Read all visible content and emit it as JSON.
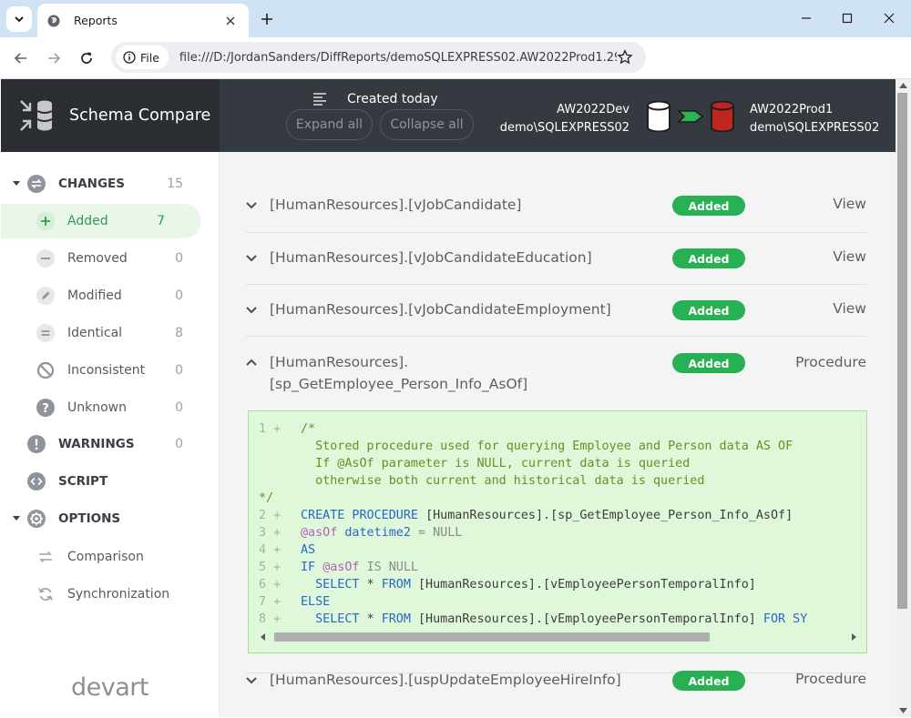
{
  "browser": {
    "tab_title": "Reports",
    "chip_label": "File",
    "url": "file:///D:/JordanSanders/DiffReports/demoSQLEXPRESS02.AW2022Prod1.29-..."
  },
  "header": {
    "brand": "Schema Compare",
    "created": "Created today",
    "expand_all": "Expand all",
    "collapse_all": "Collapse all",
    "source_db": "AW2022Dev",
    "source_server": "demo\\SQLEXPRESS02",
    "target_db": "AW2022Prod1",
    "target_server": "demo\\SQLEXPRESS02"
  },
  "sidebar": {
    "changes": {
      "label": "CHANGES",
      "count": "15"
    },
    "items": [
      {
        "label": "Added",
        "count": "7"
      },
      {
        "label": "Removed",
        "count": "0"
      },
      {
        "label": "Modified",
        "count": "0"
      },
      {
        "label": "Identical",
        "count": "8"
      },
      {
        "label": "Inconsistent",
        "count": "0"
      },
      {
        "label": "Unknown",
        "count": "0"
      }
    ],
    "warnings": {
      "label": "WARNINGS",
      "count": "0"
    },
    "script": {
      "label": "SCRIPT"
    },
    "options": {
      "label": "OPTIONS"
    },
    "option_items": [
      {
        "label": "Comparison"
      },
      {
        "label": "Synchronization"
      }
    ],
    "logo": "devart"
  },
  "main": {
    "items": [
      {
        "name": "[HumanResources].[vJobCandidate]",
        "status": "Added",
        "type": "View"
      },
      {
        "name": "[HumanResources].[vJobCandidateEducation]",
        "status": "Added",
        "type": "View"
      },
      {
        "name": "[HumanResources].[vJobCandidateEmployment]",
        "status": "Added",
        "type": "View"
      },
      {
        "name_line1": "[HumanResources].",
        "name_line2": "[sp_GetEmployee_Person_Info_AsOf]",
        "status": "Added",
        "type": "Procedure"
      },
      {
        "name": "[HumanResources].[uspUpdateEmployeeHireInfo]",
        "status": "Added",
        "type": "Procedure"
      }
    ],
    "code": {
      "l1_num": "1 +",
      "l1_a": "/*",
      "l1_b": "Stored procedure used for querying Employee and Person data AS OF",
      "l1_c": "If @AsOf parameter is NULL, current data is queried",
      "l1_d": "otherwise both current and historical data is queried",
      "l1_e": "*/",
      "l2_num": "2 +",
      "l2_kw": "CREATE PROCEDURE",
      "l2_rest": "[HumanResources].[sp_GetEmployee_Person_Info_AsOf]",
      "l3_num": "3 +",
      "l3_var": "@asOf",
      "l3_kw": "datetime2",
      "l3_rest": "= NULL",
      "l4_num": "4 +",
      "l4_kw": "AS",
      "l5_num": "5 +",
      "l5_kw": "IF",
      "l5_var": "@asOf",
      "l5_rest": "IS NULL",
      "l6_num": "6 +",
      "l6_kw1": "SELECT",
      "l6_mid": "*",
      "l6_kw2": "FROM",
      "l6_rest": "[HumanResources].[vEmployeePersonTemporalInfo]",
      "l7_num": "7 +",
      "l7_kw": "ELSE",
      "l8_num": "8 +",
      "l8_kw1": "SELECT",
      "l8_mid": "*",
      "l8_kw2": "FROM",
      "l8_rest": "[HumanResources].[vEmployeePersonTemporalInfo]",
      "l8_kw3": "FOR SY"
    }
  },
  "colors": {
    "accent_green": "#27b054",
    "header_bg": "#353a40",
    "code_bg": "#dff8d9"
  }
}
